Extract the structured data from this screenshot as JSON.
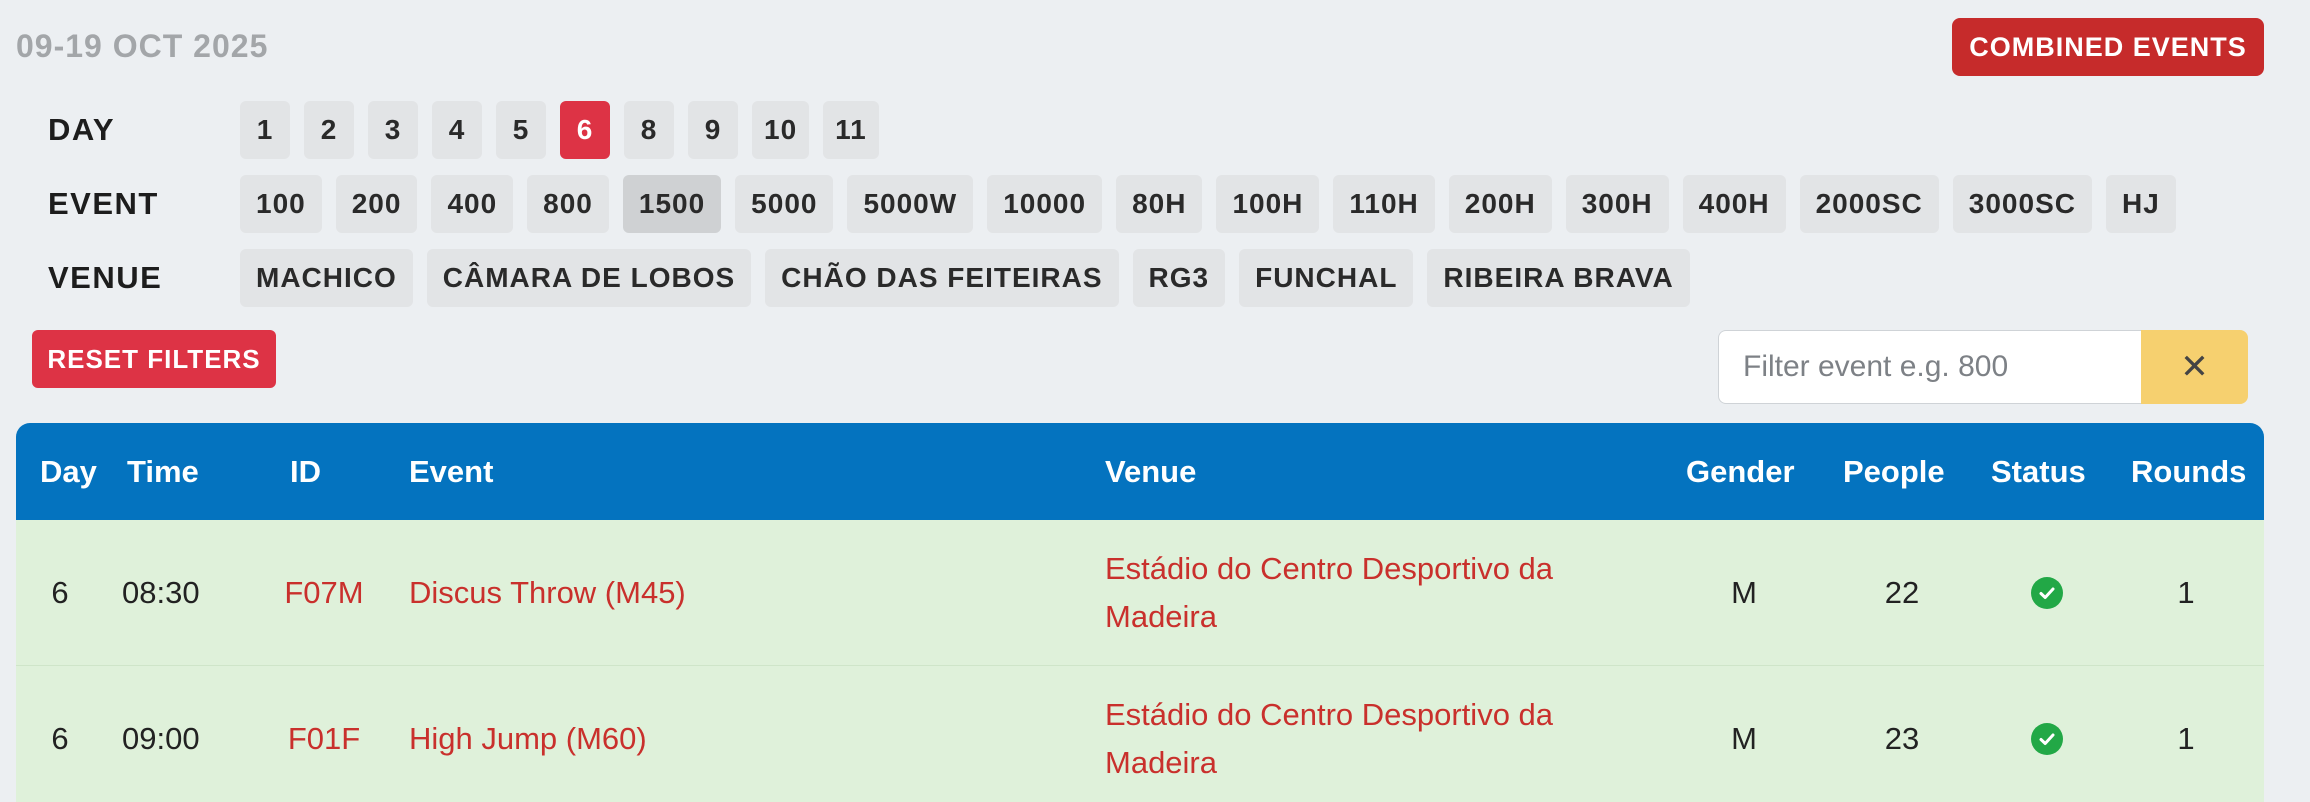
{
  "header": {
    "date_range": "09-19 OCT 2025",
    "combined_events_label": "COMBINED EVENTS"
  },
  "filters": {
    "day": {
      "label": "DAY",
      "options": [
        "1",
        "2",
        "3",
        "4",
        "5",
        "6",
        "8",
        "9",
        "10",
        "11"
      ],
      "selected": "6"
    },
    "event": {
      "label": "EVENT",
      "options": [
        "100",
        "200",
        "400",
        "800",
        "1500",
        "5000",
        "5000W",
        "10000",
        "80H",
        "100H",
        "110H",
        "200H",
        "300H",
        "400H",
        "2000SC",
        "3000SC",
        "HJ"
      ],
      "selected": "1500"
    },
    "venue": {
      "label": "VENUE",
      "options": [
        "MACHICO",
        "CÂMARA DE LOBOS",
        "CHÃO DAS FEITEIRAS",
        "RG3",
        "FUNCHAL",
        "RIBEIRA BRAVA"
      ]
    },
    "reset_label": "RESET FILTERS",
    "search": {
      "placeholder": "Filter event e.g. 800",
      "value": "",
      "clear_glyph": "✕"
    }
  },
  "table": {
    "columns": [
      "Day",
      "Time",
      "ID",
      "Event",
      "Venue",
      "Gender",
      "People",
      "Status",
      "Rounds"
    ],
    "rows": [
      {
        "day": "6",
        "time": "08:30",
        "id": "F07M",
        "event": "Discus Throw (M45)",
        "venue": "Estádio do Centro Desportivo da Madeira",
        "gender": "M",
        "people": "22",
        "status": "check-circle-icon",
        "rounds": "1"
      },
      {
        "day": "6",
        "time": "09:00",
        "id": "F01F",
        "event": "High Jump (M60)",
        "venue": "Estádio do Centro Desportivo da Madeira",
        "gender": "M",
        "people": "23",
        "status": "check-circle-icon",
        "rounds": "1"
      }
    ]
  },
  "colors": {
    "accent_red": "#dd3345",
    "header_blue": "#0473bf",
    "row_green": "#dff1da",
    "link_red": "#c9302c",
    "clear_yellow": "#f6d06f"
  }
}
